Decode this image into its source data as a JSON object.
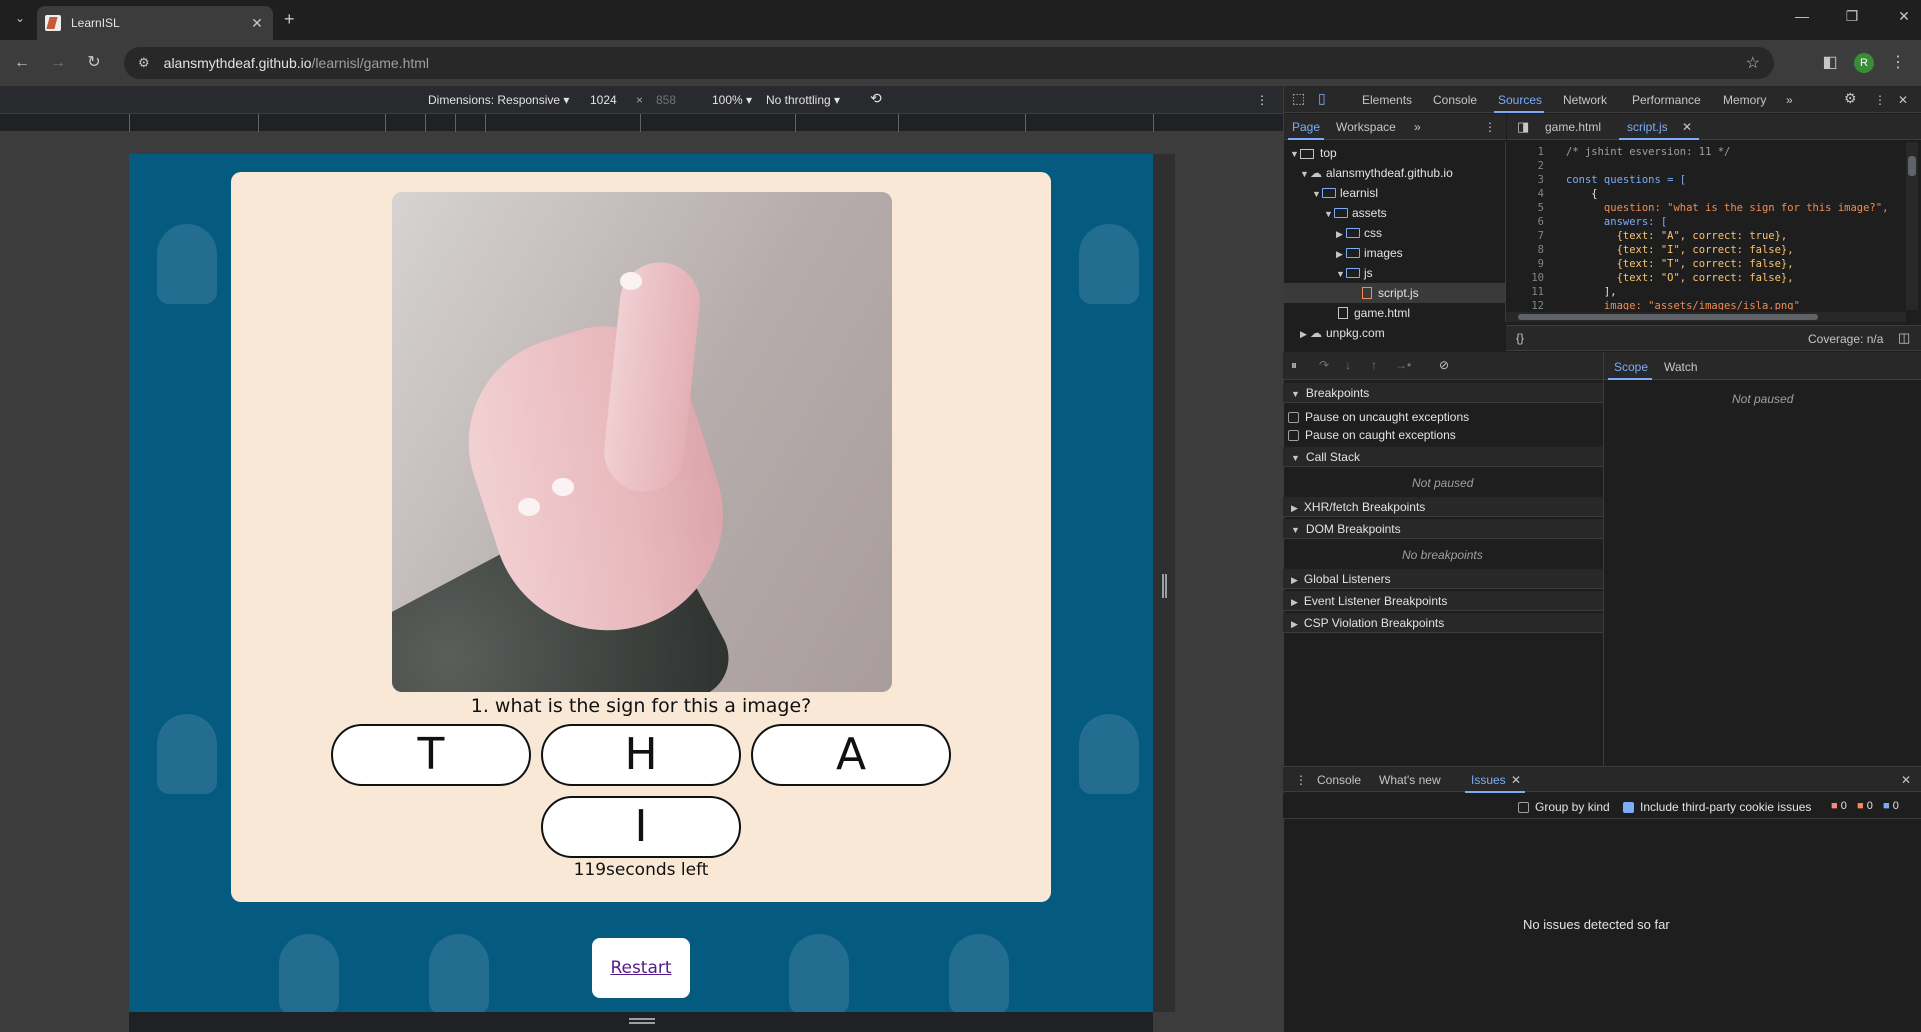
{
  "browser": {
    "tab_title": "LearnISL",
    "url_host": "alansmythdeaf.github.io",
    "url_path": "/learnisl/game.html",
    "avatar_initial": "R"
  },
  "device_toolbar": {
    "dimensions": "Dimensions: Responsive",
    "width": "1024",
    "times": "×",
    "height": "858",
    "zoom": "100%",
    "throttling": "No throttling"
  },
  "game": {
    "question": "1. what is the sign for this a image?",
    "answers": [
      "T",
      "H",
      "A",
      "I"
    ],
    "timer": "119seconds left",
    "restart": "Restart"
  },
  "devtools": {
    "tabs": [
      "Elements",
      "Console",
      "Sources",
      "Network",
      "Performance",
      "Memory"
    ],
    "active_tab": "Sources",
    "nav_tabs": [
      "Page",
      "Workspace"
    ],
    "editor_tabs": [
      "game.html",
      "script.js"
    ],
    "tree": [
      "top",
      "alansmythdeaf.github.io",
      "learnisl",
      "assets",
      "css",
      "images",
      "js",
      "script.js",
      "game.html",
      "unpkg.com"
    ],
    "coverage": "Coverage: n/a",
    "line_numbers": [
      "1",
      "2",
      "3",
      "4",
      "5",
      "6",
      "7",
      "8",
      "9",
      "10",
      "11",
      "12"
    ],
    "code_lines": [
      "/* jshint esversion: 11 */",
      "",
      "const questions = [",
      "    {",
      "      question: \"what is the sign for this image?\",",
      "      answers: [",
      "        {text: \"A\", correct: true},",
      "        {text: \"I\", correct: false},",
      "        {text: \"T\", correct: false},",
      "        {text: \"O\", correct: false},",
      "      ],",
      "      image: \"assets/images/isla.png\""
    ],
    "sections": {
      "breakpoints": "Breakpoints",
      "pause_uncaught": "Pause on uncaught exceptions",
      "pause_caught": "Pause on caught exceptions",
      "call_stack": "Call Stack",
      "not_paused": "Not paused",
      "xhr": "XHR/fetch Breakpoints",
      "dom": "DOM Breakpoints",
      "no_breakpoints": "No breakpoints",
      "global": "Global Listeners",
      "event": "Event Listener Breakpoints",
      "csp": "CSP Violation Breakpoints"
    },
    "scope_tabs": [
      "Scope",
      "Watch"
    ],
    "scope_not_paused": "Not paused",
    "drawer_tabs": [
      "Console",
      "What's new",
      "Issues"
    ],
    "group_by_kind": "Group by kind",
    "include_third_party": "Include third-party cookie issues",
    "issue_counts": [
      "0",
      "0",
      "0"
    ],
    "no_issues": "No issues detected so far"
  },
  "colors": {
    "page_bg": "#055a80",
    "card_bg": "#f9e8d6",
    "accent": "#7cacf8"
  }
}
